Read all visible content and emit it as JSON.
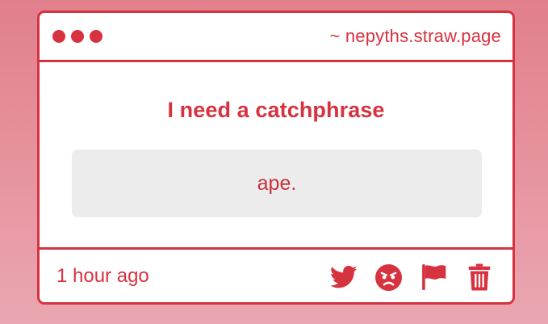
{
  "window": {
    "url": "~ nepyths.straw.page"
  },
  "question": {
    "text": "I need a catchphrase"
  },
  "answer": {
    "text": "ape."
  },
  "footer": {
    "timestamp": "1 hour ago",
    "actions": [
      {
        "icon": "twitter-icon"
      },
      {
        "icon": "angry-face-icon"
      },
      {
        "icon": "flag-icon"
      },
      {
        "icon": "trash-icon"
      }
    ]
  },
  "colors": {
    "accent": "#d6323f",
    "background_top": "#e27f8c",
    "background_bottom": "#eaa7b1",
    "answer_background": "#ececec"
  }
}
